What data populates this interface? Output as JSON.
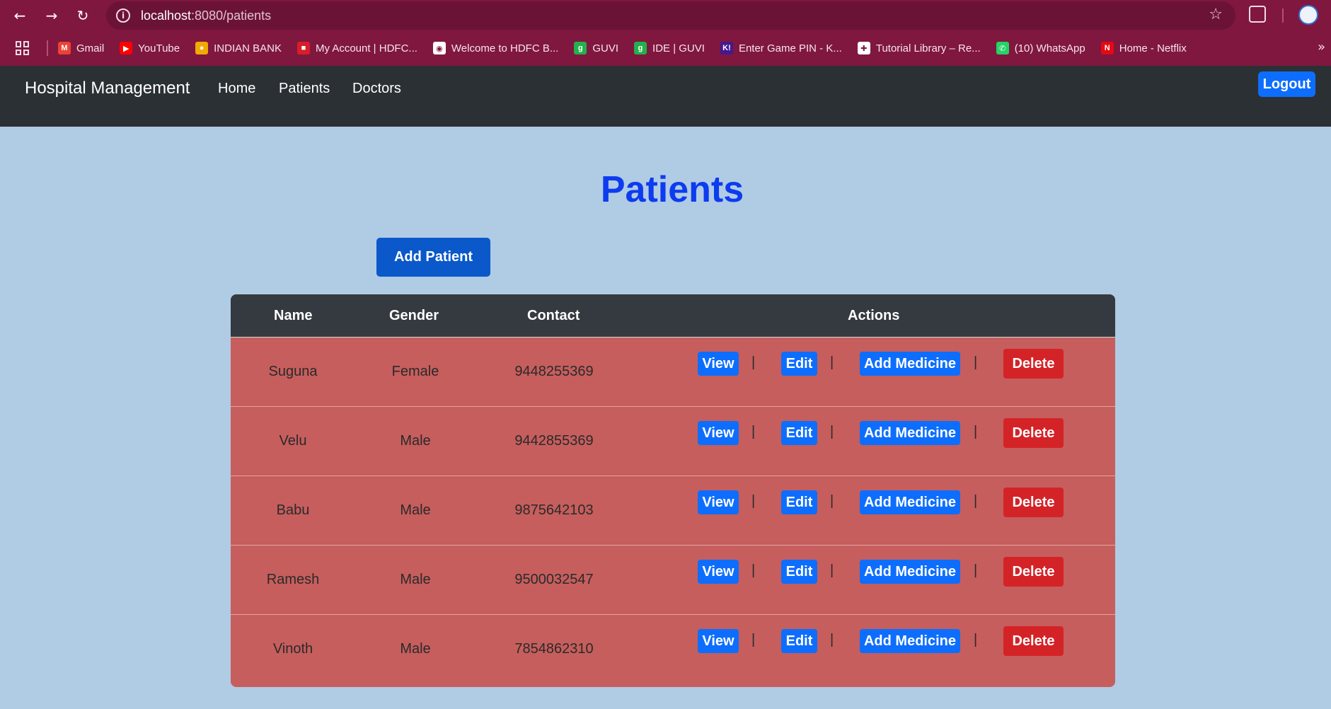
{
  "browser": {
    "url_host": "localhost",
    "url_path": ":8080/patients",
    "bookmarks": [
      {
        "label": "Gmail",
        "icon": "gmail-icon",
        "color": "#ea4335",
        "glyph": "M"
      },
      {
        "label": "YouTube",
        "icon": "youtube-icon",
        "color": "#ff0000",
        "glyph": "▶"
      },
      {
        "label": "INDIAN BANK",
        "icon": "indian-bank-icon",
        "color": "#f2a900",
        "glyph": "●"
      },
      {
        "label": "My Account | HDFC...",
        "icon": "hdfc-icon",
        "color": "#d71e28",
        "glyph": "■"
      },
      {
        "label": "Welcome to HDFC B...",
        "icon": "globe-icon",
        "color": "#ffffff",
        "glyph": "◉"
      },
      {
        "label": "GUVI",
        "icon": "guvi-icon",
        "color": "#22b14c",
        "glyph": "g"
      },
      {
        "label": "IDE | GUVI",
        "icon": "guvi-icon",
        "color": "#22b14c",
        "glyph": "g"
      },
      {
        "label": "Enter Game PIN - K...",
        "icon": "kahoot-icon",
        "color": "#46178f",
        "glyph": "K!"
      },
      {
        "label": "Tutorial Library – Re...",
        "icon": "tutorial-icon",
        "color": "#ffffff",
        "glyph": "✚"
      },
      {
        "label": "(10) WhatsApp",
        "icon": "whatsapp-icon",
        "color": "#25d366",
        "glyph": "✆"
      },
      {
        "label": "Home - Netflix",
        "icon": "netflix-icon",
        "color": "#e50914",
        "glyph": "N"
      }
    ]
  },
  "navbar": {
    "brand": "Hospital Management",
    "links": [
      "Home",
      "Patients",
      "Doctors"
    ],
    "logout_label": "Logout"
  },
  "page": {
    "title": "Patients",
    "add_patient_label": "Add Patient"
  },
  "table": {
    "headers": {
      "name": "Name",
      "gender": "Gender",
      "contact": "Contact",
      "actions": "Actions"
    },
    "rows": [
      {
        "name": "Suguna",
        "gender": "Female",
        "contact": "9448255369"
      },
      {
        "name": "Velu",
        "gender": "Male",
        "contact": "9442855369"
      },
      {
        "name": "Babu",
        "gender": "Male",
        "contact": "9875642103"
      },
      {
        "name": "Ramesh",
        "gender": "Male",
        "contact": "9500032547"
      },
      {
        "name": "Vinoth",
        "gender": "Male",
        "contact": "7854862310"
      }
    ],
    "actions": {
      "view": "View",
      "edit": "Edit",
      "add_medicine": "Add Medicine",
      "delete": "Delete",
      "separator": "|"
    }
  },
  "colors": {
    "chrome": "#80173f",
    "navbar": "#2b3035",
    "page_bg": "#b0cbe4",
    "title": "#0d3bef",
    "row_bg": "#c65e5d",
    "primary": "#0d6efd",
    "danger": "#d42327"
  }
}
